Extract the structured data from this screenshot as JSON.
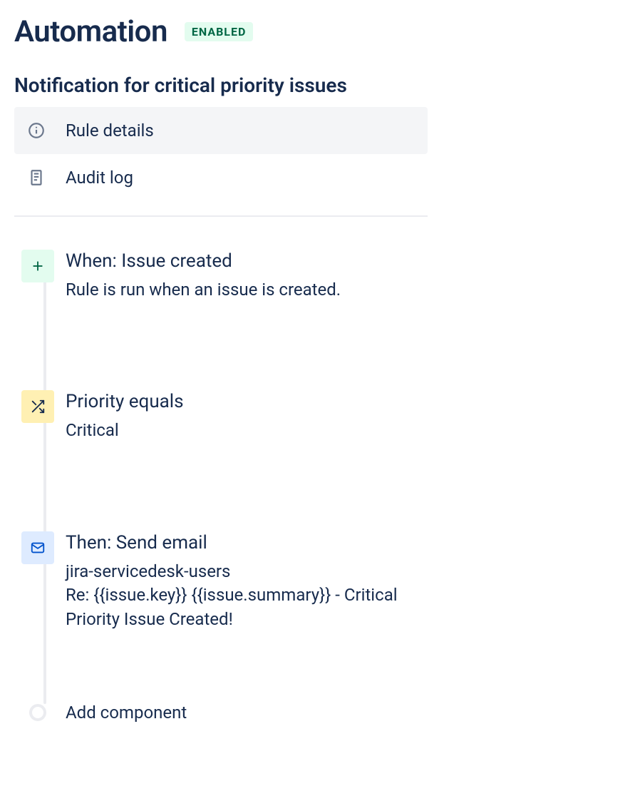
{
  "header": {
    "title": "Automation",
    "status": "ENABLED"
  },
  "rule": {
    "name": "Notification for critical priority issues"
  },
  "sidebar": {
    "rule_details": "Rule details",
    "audit_log": "Audit log"
  },
  "steps": {
    "trigger": {
      "title": "When: Issue created",
      "desc": "Rule is run when an issue is created."
    },
    "condition": {
      "title": "Priority equals",
      "desc": "Critical"
    },
    "action": {
      "title": "Then: Send email",
      "desc": "jira-servicedesk-users\nRe: {{issue.key}} {{issue.summary}} - Critical Priority Issue Created!"
    }
  },
  "add_component": "Add component"
}
